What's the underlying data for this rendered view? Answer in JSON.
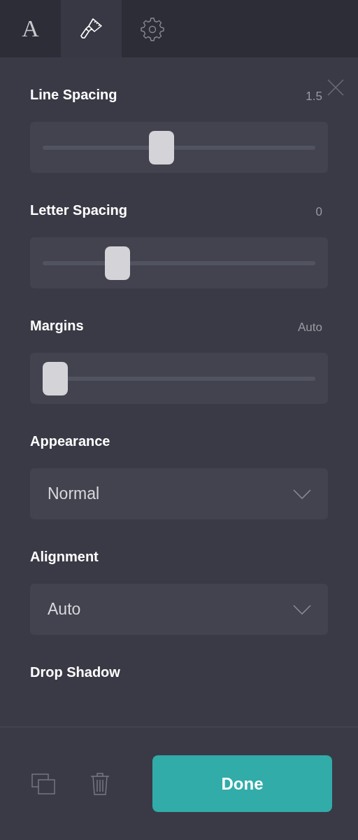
{
  "tabs": [
    {
      "label": "A",
      "selected": false
    },
    {
      "selected": true
    },
    {
      "selected": false
    }
  ],
  "sections": [
    {
      "kind": "slider",
      "label": "Line Spacing",
      "reading": "1.5",
      "level": 0.43
    },
    {
      "kind": "slider",
      "label": "Letter Spacing",
      "reading": "0",
      "level": 0.25
    },
    {
      "kind": "slider",
      "label": "Margins",
      "reading": "Auto",
      "level": 0
    },
    {
      "kind": "select",
      "label": "Appearance",
      "value": "Normal"
    },
    {
      "kind": "select",
      "label": "Alignment",
      "value": "Auto"
    },
    {
      "kind": "heading",
      "label": "Drop Shadow"
    }
  ],
  "footer": {
    "done": "Done"
  }
}
